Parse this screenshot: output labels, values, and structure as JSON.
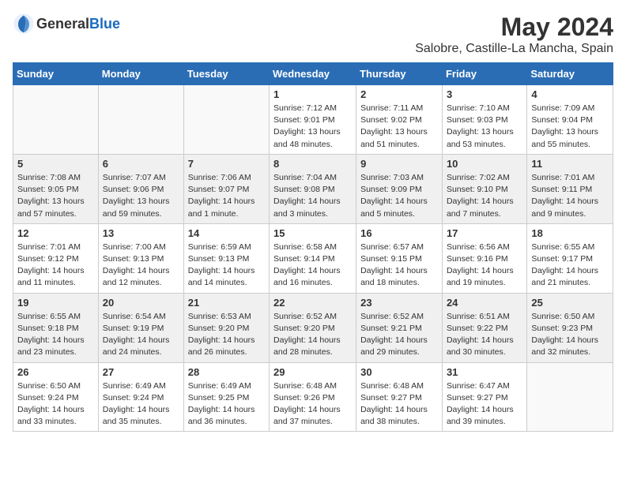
{
  "header": {
    "logo_general": "General",
    "logo_blue": "Blue",
    "title": "May 2024",
    "subtitle": "Salobre, Castille-La Mancha, Spain"
  },
  "days_of_week": [
    "Sunday",
    "Monday",
    "Tuesday",
    "Wednesday",
    "Thursday",
    "Friday",
    "Saturday"
  ],
  "weeks": [
    [
      {
        "day": "",
        "info": ""
      },
      {
        "day": "",
        "info": ""
      },
      {
        "day": "",
        "info": ""
      },
      {
        "day": "1",
        "info": "Sunrise: 7:12 AM\nSunset: 9:01 PM\nDaylight: 13 hours\nand 48 minutes."
      },
      {
        "day": "2",
        "info": "Sunrise: 7:11 AM\nSunset: 9:02 PM\nDaylight: 13 hours\nand 51 minutes."
      },
      {
        "day": "3",
        "info": "Sunrise: 7:10 AM\nSunset: 9:03 PM\nDaylight: 13 hours\nand 53 minutes."
      },
      {
        "day": "4",
        "info": "Sunrise: 7:09 AM\nSunset: 9:04 PM\nDaylight: 13 hours\nand 55 minutes."
      }
    ],
    [
      {
        "day": "5",
        "info": "Sunrise: 7:08 AM\nSunset: 9:05 PM\nDaylight: 13 hours\nand 57 minutes."
      },
      {
        "day": "6",
        "info": "Sunrise: 7:07 AM\nSunset: 9:06 PM\nDaylight: 13 hours\nand 59 minutes."
      },
      {
        "day": "7",
        "info": "Sunrise: 7:06 AM\nSunset: 9:07 PM\nDaylight: 14 hours\nand 1 minute."
      },
      {
        "day": "8",
        "info": "Sunrise: 7:04 AM\nSunset: 9:08 PM\nDaylight: 14 hours\nand 3 minutes."
      },
      {
        "day": "9",
        "info": "Sunrise: 7:03 AM\nSunset: 9:09 PM\nDaylight: 14 hours\nand 5 minutes."
      },
      {
        "day": "10",
        "info": "Sunrise: 7:02 AM\nSunset: 9:10 PM\nDaylight: 14 hours\nand 7 minutes."
      },
      {
        "day": "11",
        "info": "Sunrise: 7:01 AM\nSunset: 9:11 PM\nDaylight: 14 hours\nand 9 minutes."
      }
    ],
    [
      {
        "day": "12",
        "info": "Sunrise: 7:01 AM\nSunset: 9:12 PM\nDaylight: 14 hours\nand 11 minutes."
      },
      {
        "day": "13",
        "info": "Sunrise: 7:00 AM\nSunset: 9:13 PM\nDaylight: 14 hours\nand 12 minutes."
      },
      {
        "day": "14",
        "info": "Sunrise: 6:59 AM\nSunset: 9:13 PM\nDaylight: 14 hours\nand 14 minutes."
      },
      {
        "day": "15",
        "info": "Sunrise: 6:58 AM\nSunset: 9:14 PM\nDaylight: 14 hours\nand 16 minutes."
      },
      {
        "day": "16",
        "info": "Sunrise: 6:57 AM\nSunset: 9:15 PM\nDaylight: 14 hours\nand 18 minutes."
      },
      {
        "day": "17",
        "info": "Sunrise: 6:56 AM\nSunset: 9:16 PM\nDaylight: 14 hours\nand 19 minutes."
      },
      {
        "day": "18",
        "info": "Sunrise: 6:55 AM\nSunset: 9:17 PM\nDaylight: 14 hours\nand 21 minutes."
      }
    ],
    [
      {
        "day": "19",
        "info": "Sunrise: 6:55 AM\nSunset: 9:18 PM\nDaylight: 14 hours\nand 23 minutes."
      },
      {
        "day": "20",
        "info": "Sunrise: 6:54 AM\nSunset: 9:19 PM\nDaylight: 14 hours\nand 24 minutes."
      },
      {
        "day": "21",
        "info": "Sunrise: 6:53 AM\nSunset: 9:20 PM\nDaylight: 14 hours\nand 26 minutes."
      },
      {
        "day": "22",
        "info": "Sunrise: 6:52 AM\nSunset: 9:20 PM\nDaylight: 14 hours\nand 28 minutes."
      },
      {
        "day": "23",
        "info": "Sunrise: 6:52 AM\nSunset: 9:21 PM\nDaylight: 14 hours\nand 29 minutes."
      },
      {
        "day": "24",
        "info": "Sunrise: 6:51 AM\nSunset: 9:22 PM\nDaylight: 14 hours\nand 30 minutes."
      },
      {
        "day": "25",
        "info": "Sunrise: 6:50 AM\nSunset: 9:23 PM\nDaylight: 14 hours\nand 32 minutes."
      }
    ],
    [
      {
        "day": "26",
        "info": "Sunrise: 6:50 AM\nSunset: 9:24 PM\nDaylight: 14 hours\nand 33 minutes."
      },
      {
        "day": "27",
        "info": "Sunrise: 6:49 AM\nSunset: 9:24 PM\nDaylight: 14 hours\nand 35 minutes."
      },
      {
        "day": "28",
        "info": "Sunrise: 6:49 AM\nSunset: 9:25 PM\nDaylight: 14 hours\nand 36 minutes."
      },
      {
        "day": "29",
        "info": "Sunrise: 6:48 AM\nSunset: 9:26 PM\nDaylight: 14 hours\nand 37 minutes."
      },
      {
        "day": "30",
        "info": "Sunrise: 6:48 AM\nSunset: 9:27 PM\nDaylight: 14 hours\nand 38 minutes."
      },
      {
        "day": "31",
        "info": "Sunrise: 6:47 AM\nSunset: 9:27 PM\nDaylight: 14 hours\nand 39 minutes."
      },
      {
        "day": "",
        "info": ""
      }
    ]
  ]
}
